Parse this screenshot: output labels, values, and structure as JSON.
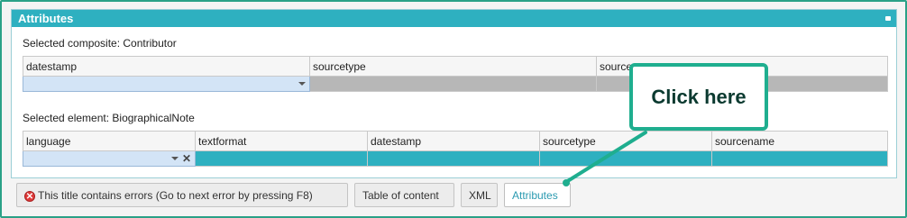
{
  "panel": {
    "title": "Attributes"
  },
  "composite": {
    "label": "Selected composite: Contributor",
    "columns": [
      "datestamp",
      "sourcetype",
      "sourcename"
    ]
  },
  "element": {
    "label": "Selected element: BiographicalNote",
    "columns": [
      "language",
      "textformat",
      "datestamp",
      "sourcetype",
      "sourcename"
    ]
  },
  "tabs": {
    "errors": "This title contains errors (Go to next error by pressing F8)",
    "toc": "Table of content",
    "xml": "XML",
    "attributes": "Attributes"
  },
  "callout": {
    "text": "Click here"
  },
  "icons": {
    "pin": "pin-icon",
    "dropdown": "chevron-down-icon",
    "clear": "close-icon",
    "error": "error-icon"
  },
  "colors": {
    "header": "#2eb0c0",
    "callout_border": "#1fae8f",
    "active_tab_text": "#2a9ab0"
  }
}
